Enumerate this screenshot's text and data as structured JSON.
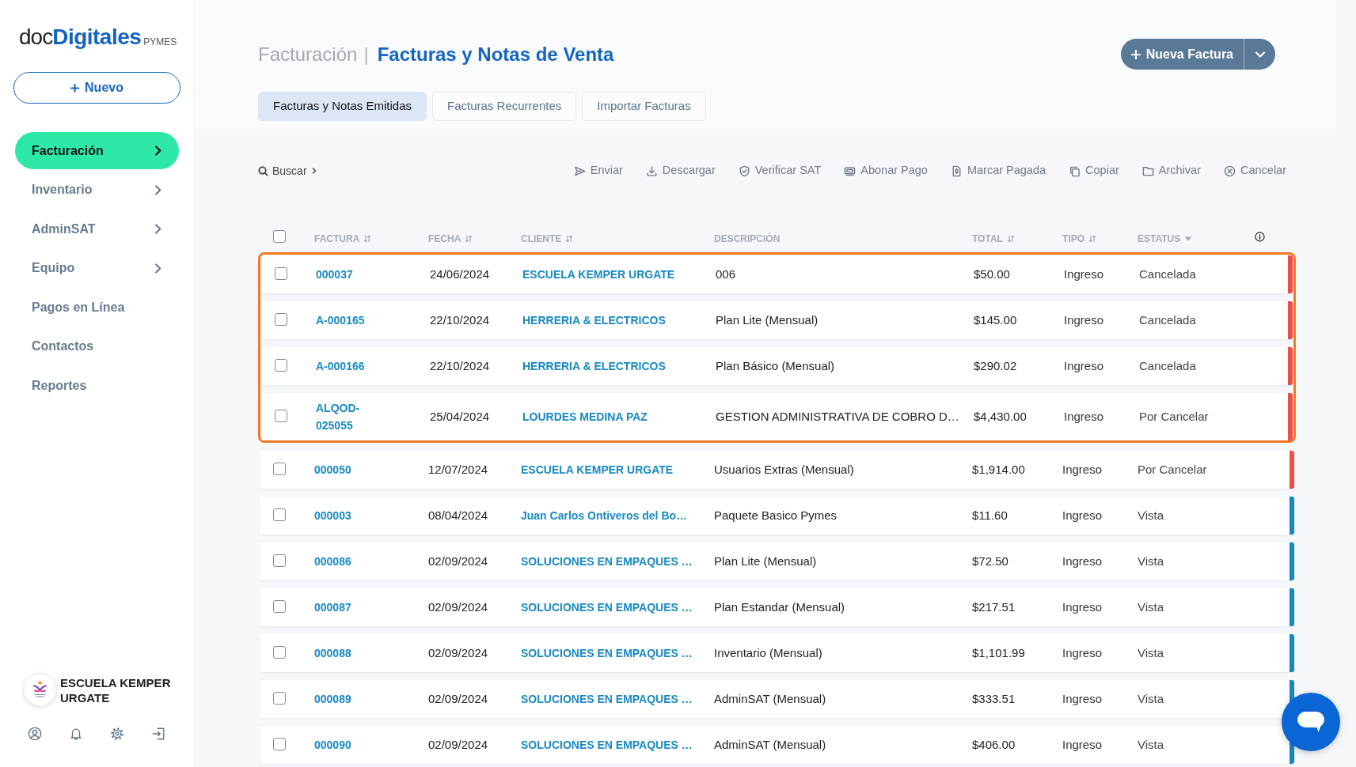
{
  "sidebar": {
    "logo": {
      "prefix": "doc",
      "name": "Digitales",
      "suffix": "PYMES"
    },
    "new_button": {
      "label": "Nuevo"
    },
    "items": [
      {
        "label": "Facturación",
        "selected": true,
        "submenu": true
      },
      {
        "label": "Inventario",
        "selected": false,
        "submenu": true
      },
      {
        "label": "AdminSAT",
        "selected": false,
        "submenu": true
      },
      {
        "label": "Equipo",
        "selected": false,
        "submenu": true
      },
      {
        "label": "Pagos en Línea",
        "selected": false,
        "submenu": false
      },
      {
        "label": "Contactos",
        "selected": false,
        "submenu": false
      },
      {
        "label": "Reportes",
        "selected": false,
        "submenu": false
      }
    ],
    "account": {
      "name": "ESCUELA KEMPER URGATE"
    }
  },
  "header": {
    "section": "Facturación",
    "separator": "|",
    "title": "Facturas y Notas de Venta",
    "primary_button": {
      "label": "Nueva Factura"
    }
  },
  "tabs": [
    {
      "label": "Facturas y Notas Emitidas",
      "selected": true
    },
    {
      "label": "Facturas Recurrentes",
      "selected": false
    },
    {
      "label": "Importar Facturas",
      "selected": false
    }
  ],
  "toolbar": {
    "search": {
      "label": "Buscar"
    },
    "actions": [
      {
        "kind": "send",
        "label": "Enviar"
      },
      {
        "kind": "download",
        "label": "Descargar"
      },
      {
        "kind": "verify",
        "label": "Verificar SAT"
      },
      {
        "kind": "payment",
        "label": "Abonar Pago"
      },
      {
        "kind": "mark_paid",
        "label": "Marcar Pagada"
      },
      {
        "kind": "copy",
        "label": "Copiar"
      },
      {
        "kind": "archive",
        "label": "Archivar"
      },
      {
        "kind": "cancel",
        "label": "Cancelar"
      }
    ]
  },
  "table": {
    "select_all": {
      "checked": false
    },
    "columns": [
      {
        "label": "FACTURA",
        "kind": "sortable"
      },
      {
        "label": "FECHA",
        "kind": "sortable"
      },
      {
        "label": "CLIENTE",
        "kind": "sortable"
      },
      {
        "label": "DESCRIPCIÓN",
        "kind": "plain"
      },
      {
        "label": "TOTAL",
        "kind": "sortable"
      },
      {
        "label": "TIPO",
        "kind": "sortable"
      },
      {
        "label": "ESTATUS",
        "kind": "filter"
      }
    ],
    "rows": [
      {
        "invoice": "000037",
        "date": "24/06/2024",
        "client": "ESCUELA KEMPER URGATE",
        "description": "006",
        "total": "$50.00",
        "type": "Ingreso",
        "status": "Cancelada",
        "color": "#ef4d48",
        "checked": false,
        "highlighted": true
      },
      {
        "invoice": "A-000165",
        "date": "22/10/2024",
        "client": "HERRERIA & ELECTRICOS",
        "description": "Plan Lite (Mensual)",
        "total": "$145.00",
        "type": "Ingreso",
        "status": "Cancelada",
        "color": "#ef4d48",
        "checked": false,
        "highlighted": true
      },
      {
        "invoice": "A-000166",
        "date": "22/10/2024",
        "client": "HERRERIA & ELECTRICOS",
        "description": "Plan Básico (Mensual)",
        "total": "$290.02",
        "type": "Ingreso",
        "status": "Cancelada",
        "color": "#ef4d48",
        "checked": false,
        "highlighted": true
      },
      {
        "invoice": "ALQOD-025055",
        "date": "25/04/2024",
        "client": "LOURDES MEDINA PAZ",
        "description": "GESTION ADMINISTRATIVA DE COBRO D…",
        "total": "$4,430.00",
        "type": "Ingreso",
        "status": "Por Cancelar",
        "color": "#ef4d48",
        "checked": false,
        "highlighted": true
      },
      {
        "invoice": "000050",
        "date": "12/07/2024",
        "client": "ESCUELA KEMPER URGATE",
        "description": "Usuarios Extras (Mensual)",
        "total": "$1,914.00",
        "type": "Ingreso",
        "status": "Por Cancelar",
        "color": "#ef4d48",
        "checked": false,
        "highlighted": false
      },
      {
        "invoice": "000003",
        "date": "08/04/2024",
        "client": "Juan Carlos Ontiveros del Bo…",
        "description": "Paquete Basico Pymes",
        "total": "$11.60",
        "type": "Ingreso",
        "status": "Vista",
        "color": "#1787c3",
        "checked": false,
        "highlighted": false
      },
      {
        "invoice": "000086",
        "date": "02/09/2024",
        "client": "SOLUCIONES EN EMPAQUES …",
        "description": "Plan Lite (Mensual)",
        "total": "$72.50",
        "type": "Ingreso",
        "status": "Vista",
        "color": "#1787c3",
        "checked": false,
        "highlighted": false
      },
      {
        "invoice": "000087",
        "date": "02/09/2024",
        "client": "SOLUCIONES EN EMPAQUES …",
        "description": "Plan Estandar (Mensual)",
        "total": "$217.51",
        "type": "Ingreso",
        "status": "Vista",
        "color": "#1787c3",
        "checked": false,
        "highlighted": false
      },
      {
        "invoice": "000088",
        "date": "02/09/2024",
        "client": "SOLUCIONES EN EMPAQUES …",
        "description": "Inventario (Mensual)",
        "total": "$1,101.99",
        "type": "Ingreso",
        "status": "Vista",
        "color": "#1787c3",
        "checked": false,
        "highlighted": false
      },
      {
        "invoice": "000089",
        "date": "02/09/2024",
        "client": "SOLUCIONES EN EMPAQUES …",
        "description": "AdminSAT (Mensual)",
        "total": "$333.51",
        "type": "Ingreso",
        "status": "Vista",
        "color": "#1787c3",
        "checked": false,
        "highlighted": false
      },
      {
        "invoice": "000090",
        "date": "02/09/2024",
        "client": "SOLUCIONES EN EMPAQUES …",
        "description": "AdminSAT (Mensual)",
        "total": "$406.00",
        "type": "Ingreso",
        "status": "Vista",
        "color": "#1787c3",
        "checked": false,
        "highlighted": false
      }
    ]
  }
}
